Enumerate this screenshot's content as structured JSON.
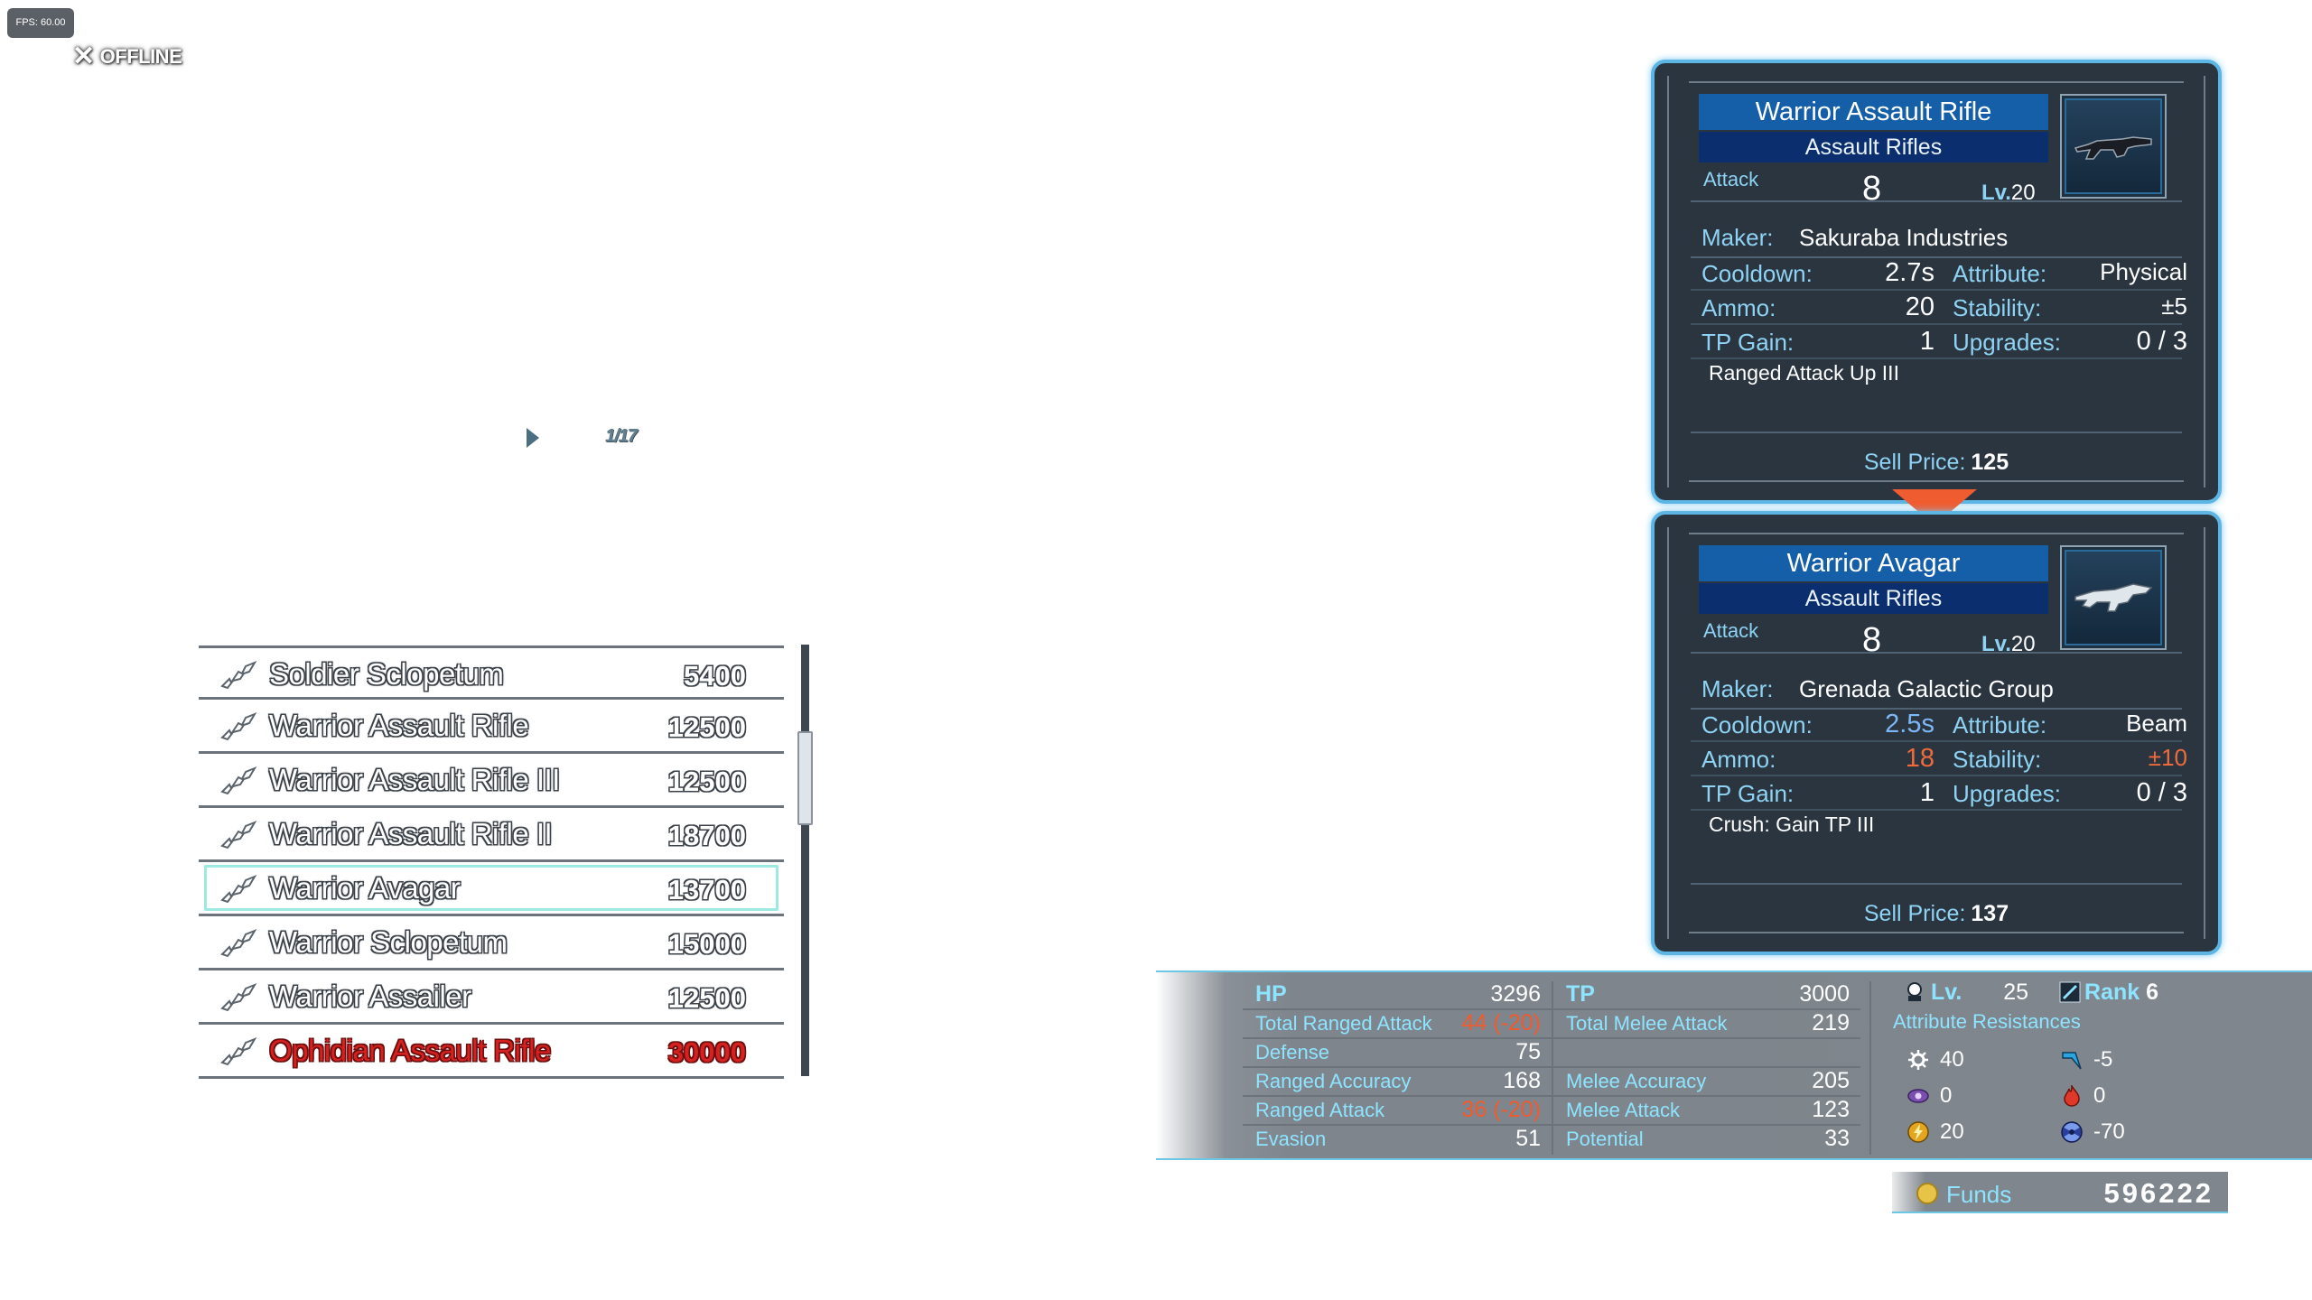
{
  "hud": {
    "fps": "FPS: 60.00",
    "offline_label": "OFFLINE"
  },
  "pager": {
    "page_text": "1/17"
  },
  "weapon_list": {
    "items": [
      {
        "name": "Soldier Sclopetum",
        "price": "5400",
        "highlight": false,
        "unaffordable": false
      },
      {
        "name": "Warrior Assault Rifle",
        "price": "12500",
        "highlight": false,
        "unaffordable": false
      },
      {
        "name": "Warrior Assault Rifle III",
        "price": "12500",
        "highlight": false,
        "unaffordable": false
      },
      {
        "name": "Warrior Assault Rifle II",
        "price": "18700",
        "highlight": false,
        "unaffordable": false
      },
      {
        "name": "Warrior Avagar",
        "price": "13700",
        "highlight": true,
        "unaffordable": false
      },
      {
        "name": "Warrior Sclopetum",
        "price": "15000",
        "highlight": false,
        "unaffordable": false
      },
      {
        "name": "Warrior Assailer",
        "price": "12500",
        "highlight": false,
        "unaffordable": false
      },
      {
        "name": "Ophidian Assault Rifle",
        "price": "30000",
        "highlight": false,
        "unaffordable": true
      }
    ]
  },
  "equipped": {
    "name": "Warrior Assault Rifle",
    "category": "Assault Rifles",
    "attack_label": "Attack",
    "attack": "8",
    "lv_label": "Lv.",
    "lv": "20",
    "maker_label": "Maker:",
    "maker": "Sakuraba Industries",
    "cooldown_label": "Cooldown:",
    "cooldown": "2.7s",
    "attribute_label": "Attribute:",
    "attribute": "Physical",
    "ammo_label": "Ammo:",
    "ammo": "20",
    "stability_label": "Stability:",
    "stability": "±5",
    "tp_gain_label": "TP Gain:",
    "tp_gain": "1",
    "upgrades_label": "Upgrades:",
    "upgrades": "0 / 3",
    "ability": "Ranged Attack Up III",
    "sell_label": "Sell Price:",
    "sell_price": "125"
  },
  "candidate": {
    "name": "Warrior Avagar",
    "category": "Assault Rifles",
    "attack_label": "Attack",
    "attack": "8",
    "lv_label": "Lv.",
    "lv": "20",
    "maker_label": "Maker:",
    "maker": "Grenada Galactic Group",
    "cooldown_label": "Cooldown:",
    "cooldown": "2.5s",
    "attribute_label": "Attribute:",
    "attribute": "Beam",
    "ammo_label": "Ammo:",
    "ammo": "18",
    "stability_label": "Stability:",
    "stability": "±10",
    "tp_gain_label": "TP Gain:",
    "tp_gain": "1",
    "upgrades_label": "Upgrades:",
    "upgrades": "0 / 3",
    "ability": "Crush: Gain TP III",
    "sell_label": "Sell Price:",
    "sell_price": "137"
  },
  "stats": {
    "left": [
      {
        "label": "HP",
        "value": "3296",
        "penalty": ""
      },
      {
        "label": "Total Ranged Attack",
        "value": "44",
        "penalty": "(-20)"
      },
      {
        "label": "Defense",
        "value": "75",
        "penalty": ""
      },
      {
        "label": "Ranged Accuracy",
        "value": "168",
        "penalty": ""
      },
      {
        "label": "Ranged Attack",
        "value": "36",
        "penalty": "(-20)"
      },
      {
        "label": "Evasion",
        "value": "51",
        "penalty": ""
      }
    ],
    "right": [
      {
        "label": "TP",
        "value": "3000"
      },
      {
        "label": "Total Melee Attack",
        "value": "219"
      },
      {
        "label": "",
        "value": ""
      },
      {
        "label": "Melee Accuracy",
        "value": "205"
      },
      {
        "label": "Melee Attack",
        "value": "123"
      },
      {
        "label": "Potential",
        "value": "33"
      }
    ]
  },
  "character": {
    "lv_label": "Lv.",
    "lv": "25",
    "rank_label": "Rank",
    "rank": "6",
    "resist_label": "Attribute Resistances",
    "resistances": [
      {
        "icon": "physical-icon",
        "value": "40"
      },
      {
        "icon": "beam-icon",
        "value": "-5"
      },
      {
        "icon": "psychic-icon",
        "value": "0"
      },
      {
        "icon": "fire-icon",
        "value": "0"
      },
      {
        "icon": "electric-icon",
        "value": "20"
      },
      {
        "icon": "radiation-icon",
        "value": "-70"
      }
    ]
  },
  "funds": {
    "label": "Funds",
    "value": "596222"
  },
  "colors": {
    "accent": "#5db5e4",
    "title_bar": "#155ea8",
    "category_bar": "#0b2f6e",
    "penalty": "#f25a2d",
    "improved": "#7db7f5",
    "unaffordable": "#d72020"
  }
}
